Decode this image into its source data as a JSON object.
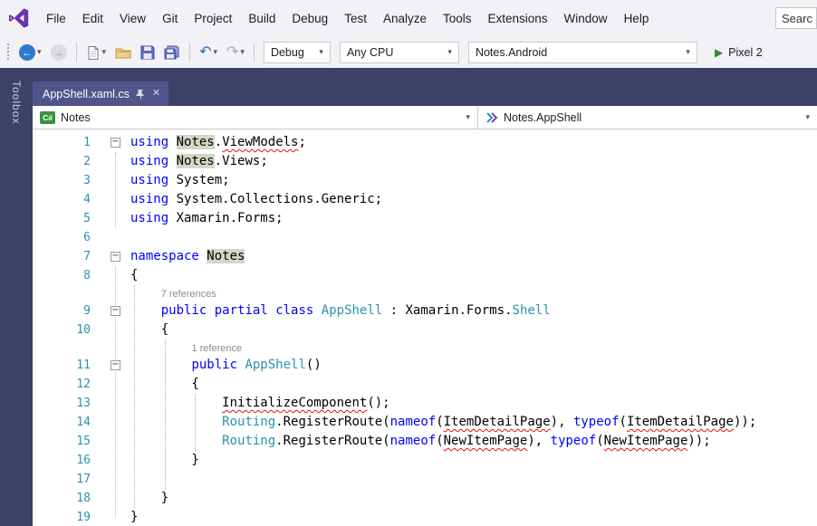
{
  "colors": {
    "workspace_background": "#3E4066",
    "tab_active": "#50548A",
    "keyword": "#0000FF",
    "type_name": "#2B91AF",
    "line_number": "#2B91AF",
    "error_squiggle": "#E51400",
    "reference_highlight": "#D3D8C5",
    "run_green": "#388A34"
  },
  "icons": {
    "caret": "▾",
    "back": "←",
    "forward": "→",
    "undo": "↶",
    "redo": "↷",
    "play": "▶",
    "close": "✕"
  },
  "menubar": {
    "items": [
      "File",
      "Edit",
      "View",
      "Git",
      "Project",
      "Build",
      "Debug",
      "Test",
      "Analyze",
      "Tools",
      "Extensions",
      "Window",
      "Help"
    ],
    "search_text": "Searc"
  },
  "toolbar": {
    "configuration": "Debug",
    "platform": "Any CPU",
    "startup_project": "Notes.Android",
    "run_target": "Pixel 2"
  },
  "document_tabs": [
    {
      "label": "AppShell.xaml.cs",
      "active": true
    }
  ],
  "side_panel": {
    "toolbox_label": "Toolbox"
  },
  "navigation_bar": {
    "csharp_badge": "C#",
    "project": "Notes",
    "type": "Notes.AppShell"
  },
  "editor": {
    "language": "csharp",
    "lines": [
      {
        "n": 1,
        "fold": true,
        "seg": [
          [
            "using",
            "k"
          ],
          [
            " ",
            "p"
          ],
          [
            "Notes",
            "h"
          ],
          [
            ".",
            "p"
          ],
          [
            "ViewModels",
            "s"
          ],
          [
            ";",
            "p"
          ]
        ]
      },
      {
        "n": 2,
        "seg": [
          [
            "using",
            "k"
          ],
          [
            " ",
            "p"
          ],
          [
            "Notes",
            "h"
          ],
          [
            ".Views;",
            "p"
          ]
        ]
      },
      {
        "n": 3,
        "seg": [
          [
            "using",
            "k"
          ],
          [
            " System;",
            "p"
          ]
        ]
      },
      {
        "n": 4,
        "seg": [
          [
            "using",
            "k"
          ],
          [
            " System.Collections.Generic;",
            "p"
          ]
        ]
      },
      {
        "n": 5,
        "seg": [
          [
            "using",
            "k"
          ],
          [
            " Xamarin.Forms;",
            "p"
          ]
        ]
      },
      {
        "n": 6,
        "seg": []
      },
      {
        "n": 7,
        "fold": true,
        "seg": [
          [
            "namespace",
            "k"
          ],
          [
            " ",
            "p"
          ],
          [
            "Notes",
            "h"
          ]
        ]
      },
      {
        "n": 8,
        "seg": [
          [
            "{",
            "p"
          ]
        ]
      },
      {
        "n": 9,
        "fold": true,
        "lens": "7 references",
        "pad": 4,
        "seg": [
          [
            "    ",
            "p"
          ],
          [
            "public",
            "k"
          ],
          [
            " ",
            "p"
          ],
          [
            "partial",
            "k"
          ],
          [
            " ",
            "p"
          ],
          [
            "class",
            "k"
          ],
          [
            " ",
            "p"
          ],
          [
            "AppShell",
            "t"
          ],
          [
            " : Xamarin.Forms.",
            "p"
          ],
          [
            "Shell",
            "t"
          ]
        ]
      },
      {
        "n": 10,
        "seg": [
          [
            "    {",
            "p"
          ]
        ]
      },
      {
        "n": 11,
        "fold": true,
        "lens": "1 reference",
        "pad": 8,
        "seg": [
          [
            "        ",
            "p"
          ],
          [
            "public",
            "k"
          ],
          [
            " ",
            "p"
          ],
          [
            "AppShell",
            "t"
          ],
          [
            "()",
            "p"
          ]
        ]
      },
      {
        "n": 12,
        "seg": [
          [
            "        {",
            "p"
          ]
        ]
      },
      {
        "n": 13,
        "seg": [
          [
            "            ",
            "p"
          ],
          [
            "InitializeComponent",
            "s"
          ],
          [
            "();",
            "p"
          ]
        ]
      },
      {
        "n": 14,
        "seg": [
          [
            "            ",
            "p"
          ],
          [
            "Routing",
            "t"
          ],
          [
            ".RegisterRoute(",
            "p"
          ],
          [
            "nameof",
            "k"
          ],
          [
            "(",
            "p"
          ],
          [
            "ItemDetailPage",
            "s"
          ],
          [
            "), ",
            "p"
          ],
          [
            "typeof",
            "k"
          ],
          [
            "(",
            "p"
          ],
          [
            "ItemDetailPage",
            "s"
          ],
          [
            "));",
            "p"
          ]
        ]
      },
      {
        "n": 15,
        "seg": [
          [
            "            ",
            "p"
          ],
          [
            "Routing",
            "t"
          ],
          [
            ".RegisterRoute(",
            "p"
          ],
          [
            "nameof",
            "k"
          ],
          [
            "(",
            "p"
          ],
          [
            "NewItemPage",
            "s"
          ],
          [
            "), ",
            "p"
          ],
          [
            "typeof",
            "k"
          ],
          [
            "(",
            "p"
          ],
          [
            "NewItemPage",
            "s"
          ],
          [
            "));",
            "p"
          ]
        ]
      },
      {
        "n": 16,
        "seg": [
          [
            "        }",
            "p"
          ]
        ]
      },
      {
        "n": 17,
        "seg": []
      },
      {
        "n": 18,
        "seg": [
          [
            "    }",
            "p"
          ]
        ]
      },
      {
        "n": 19,
        "seg": [
          [
            "}",
            "p"
          ]
        ]
      }
    ]
  }
}
